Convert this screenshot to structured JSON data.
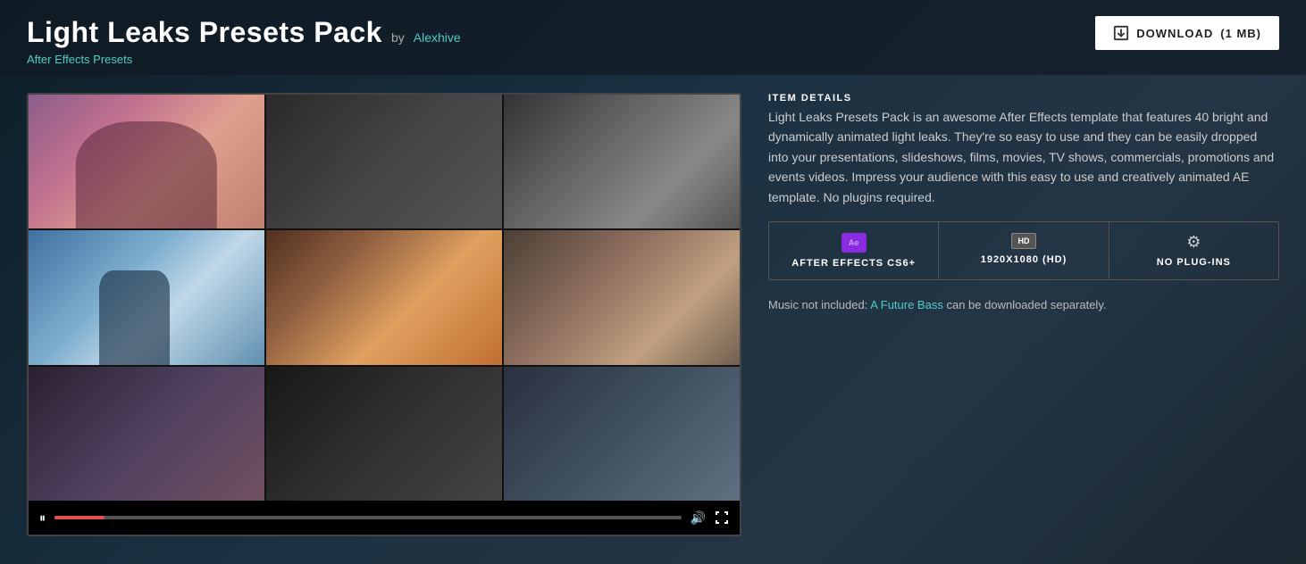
{
  "header": {
    "title": "Light Leaks Presets Pack",
    "by_label": "by",
    "author": "Alexhive",
    "breadcrumb": "After Effects Presets",
    "download_label": "DOWNLOAD",
    "download_size": "(1 MB)"
  },
  "details": {
    "section_label": "ITEM DETAILS",
    "description": "Light Leaks Presets Pack is an awesome After Effects template that features 40 bright and dynamically animated light leaks. They're so easy to use and they can be easily dropped into your presentations, slideshows, films, movies, TV shows, commercials, promotions and events videos. Impress your audience with this easy to use and creatively animated AE template. No plugins required.",
    "specs": [
      {
        "icon": "ae",
        "label": "AFTER EFFECTS CS6+"
      },
      {
        "icon": "hd",
        "label": "1920X1080 (HD)"
      },
      {
        "icon": "gear",
        "label": "NO PLUG-INS"
      }
    ],
    "music_note": "Music not included:",
    "music_link": "A Future Bass",
    "music_suffix": "can be downloaded separately."
  },
  "video": {
    "play_icon": "⏸",
    "volume_icon": "🔊",
    "fullscreen_icon": "⛶"
  }
}
